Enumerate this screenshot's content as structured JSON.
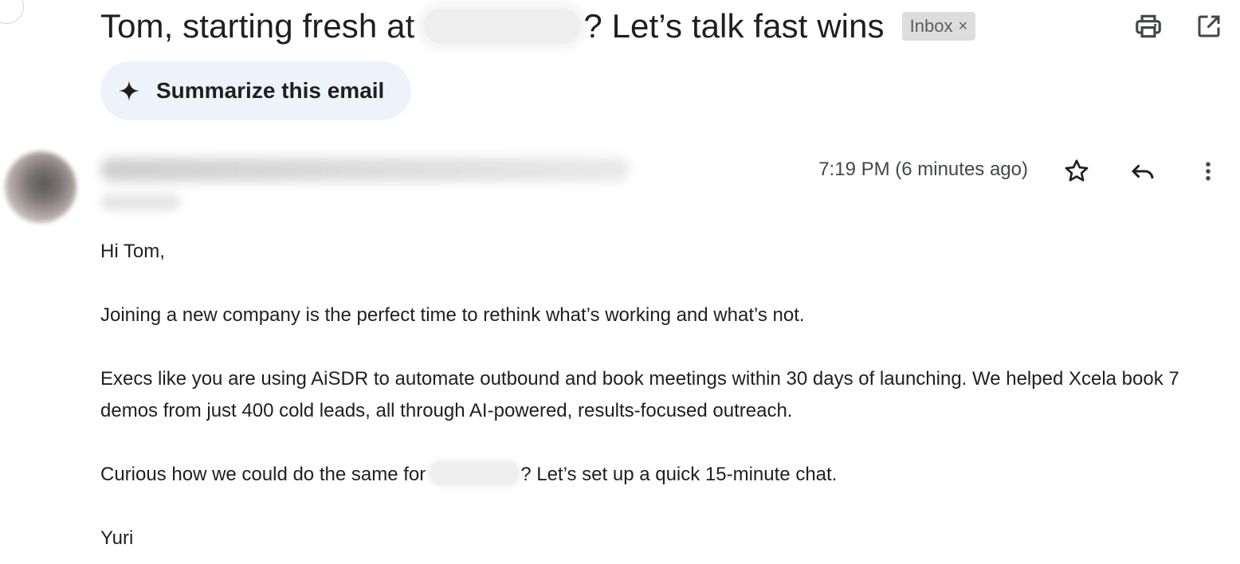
{
  "subject": {
    "title_before": "Tom, starting fresh at",
    "title_after": "? Let’s talk fast wins",
    "label": "Inbox",
    "label_remove": "×"
  },
  "toolbar": {
    "print_icon": "print-icon",
    "open_new_window_icon": "open-in-new-window-icon"
  },
  "summarize": {
    "icon": "sparkle-icon",
    "label": "Summarize this email"
  },
  "message": {
    "timestamp": "7:19 PM (6 minutes ago)",
    "star_icon": "star-icon",
    "reply_icon": "reply-icon",
    "more_icon": "more-vertical-icon",
    "body": {
      "greeting": "Hi Tom,",
      "para1": "Joining a new company is the perfect time to rethink what’s working and what’s not.",
      "para2": "Execs like you are using AiSDR to automate outbound and book meetings within 30 days of launching. We helped Xcela book 7 demos from just 400 cold leads, all through AI-powered, results-focused outreach.",
      "para3_before": "Curious how we could do the same for",
      "para3_after": "? Let’s set up a quick 15-minute chat.",
      "signature": "Yuri"
    }
  },
  "colors": {
    "summarize_bg": "#eef2fa",
    "label_chip_bg": "#dddddd",
    "text": "#1f1f1f",
    "secondary_text": "#444746"
  }
}
